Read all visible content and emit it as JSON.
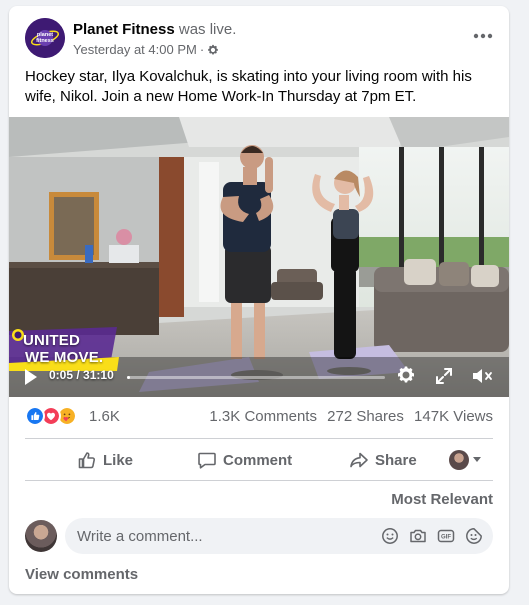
{
  "post": {
    "author": "Planet Fitness",
    "action": "was live.",
    "timestamp": "Yesterday at 4:00 PM",
    "separator": "·",
    "privacy_icon": "gear-icon",
    "more_icon": "more-options-icon",
    "text": "Hockey star, Ilya Kovalchuk, is skating into your living room with his wife, Nikol. Join a new Home Work-In Thursday at 7pm ET.",
    "avatar_text": "planet fitness"
  },
  "video": {
    "overlay_line1": "UNITED",
    "overlay_line2": "WE MOVE.",
    "current_time": "0:05",
    "duration": "31:10",
    "time_separator": " / ",
    "progress_fraction": 0.0027
  },
  "engagement": {
    "reaction_icons": [
      "like-reaction-icon",
      "love-reaction-icon",
      "care-reaction-icon"
    ],
    "reaction_count": "1.6K",
    "comments": "1.3K Comments",
    "shares": "272 Shares",
    "views": "147K Views"
  },
  "actions": {
    "like": "Like",
    "comment": "Comment",
    "share": "Share"
  },
  "comments_section": {
    "sort_label": "Most Relevant",
    "placeholder": "Write a comment...",
    "tools": [
      "emoji-icon",
      "camera-icon",
      "gif-icon",
      "sticker-icon"
    ],
    "view_comments": "View comments"
  },
  "colors": {
    "brand_purple": "#3e1a73",
    "brand_yellow": "#f9de19",
    "text_secondary": "#65676b",
    "like_blue": "#1877f2",
    "love_red": "#f33e58"
  }
}
